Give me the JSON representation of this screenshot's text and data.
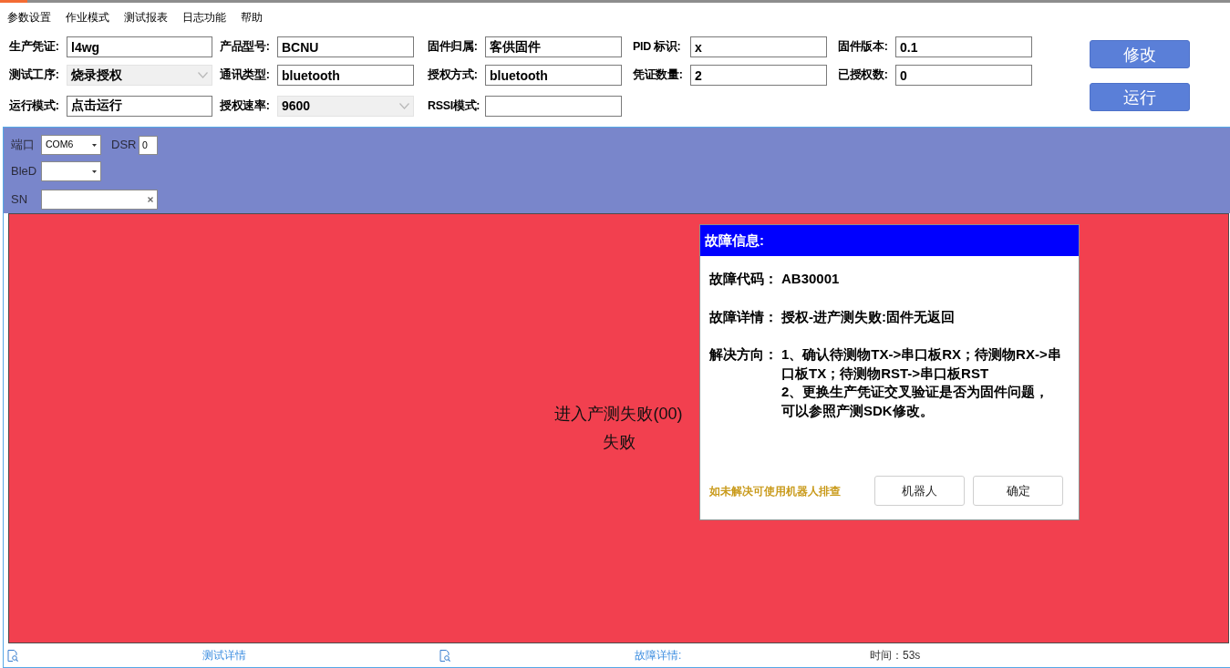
{
  "menu": [
    {
      "label": "参数设置"
    },
    {
      "label": "作业模式"
    },
    {
      "label": "测试报表"
    },
    {
      "label": "日志功能"
    },
    {
      "label": "帮助"
    }
  ],
  "form": {
    "rows": [
      [
        {
          "label": "生产凭证:",
          "kind": "text",
          "value": "l4wg"
        },
        {
          "label": "产品型号:",
          "kind": "text",
          "value": "BCNU"
        },
        {
          "label": "固件归属:",
          "kind": "text",
          "value": "客供固件"
        },
        {
          "label": "PID 标识:",
          "kind": "text",
          "value": "x"
        },
        {
          "label": "固件版本:",
          "kind": "text",
          "value": "0.1"
        }
      ],
      [
        {
          "label": "测试工序:",
          "kind": "select",
          "value": "烧录授权"
        },
        {
          "label": "通讯类型:",
          "kind": "text",
          "value": "bluetooth"
        },
        {
          "label": "授权方式:",
          "kind": "text",
          "value": "bluetooth"
        },
        {
          "label": "凭证数量:",
          "kind": "text",
          "value": "2"
        },
        {
          "label": "已授权数:",
          "kind": "text",
          "value": "0"
        }
      ],
      [
        {
          "label": "运行模式:",
          "kind": "text",
          "value": "点击运行"
        },
        {
          "label": "授权速率:",
          "kind": "select",
          "value": "9600"
        },
        {
          "label": "RSSI模式:",
          "kind": "text"
        }
      ]
    ]
  },
  "actions": [
    "修改",
    "运行"
  ],
  "port_panel": {
    "port": {
      "label": "端口",
      "value": "COM6"
    },
    "dsr": {
      "label": "DSR",
      "value": "0"
    },
    "ble": {
      "label": "BleD"
    },
    "sn": {
      "label": "SN"
    }
  },
  "result": {
    "lines": [
      "进入产测失败(00)",
      "失败"
    ]
  },
  "fault_dialog": {
    "title": "故障信息:",
    "entries": [
      {
        "label": "故障代码：",
        "lines": [
          "AB30001"
        ]
      },
      {
        "label": "故障详情：",
        "lines": [
          "授权-进产测失败:固件无返回"
        ]
      },
      {
        "label": "解决方向：",
        "lines": [
          "1、确认待测物TX->串口板RX；待测物RX->串口板TX；待测物RST->串口板RST",
          "2、更换生产凭证交叉验证是否为固件问题，可以参照产测SDK修改。"
        ]
      }
    ],
    "hint": "如未解决可使用机器人排查",
    "buttons": [
      "机器人",
      "确定"
    ]
  },
  "status_bar": {
    "sections": [
      {
        "kind": "link",
        "text": "测试详情"
      },
      {
        "kind": "link",
        "text": "故障详情:"
      },
      {
        "kind": "text",
        "text": "时间：53s"
      }
    ]
  }
}
